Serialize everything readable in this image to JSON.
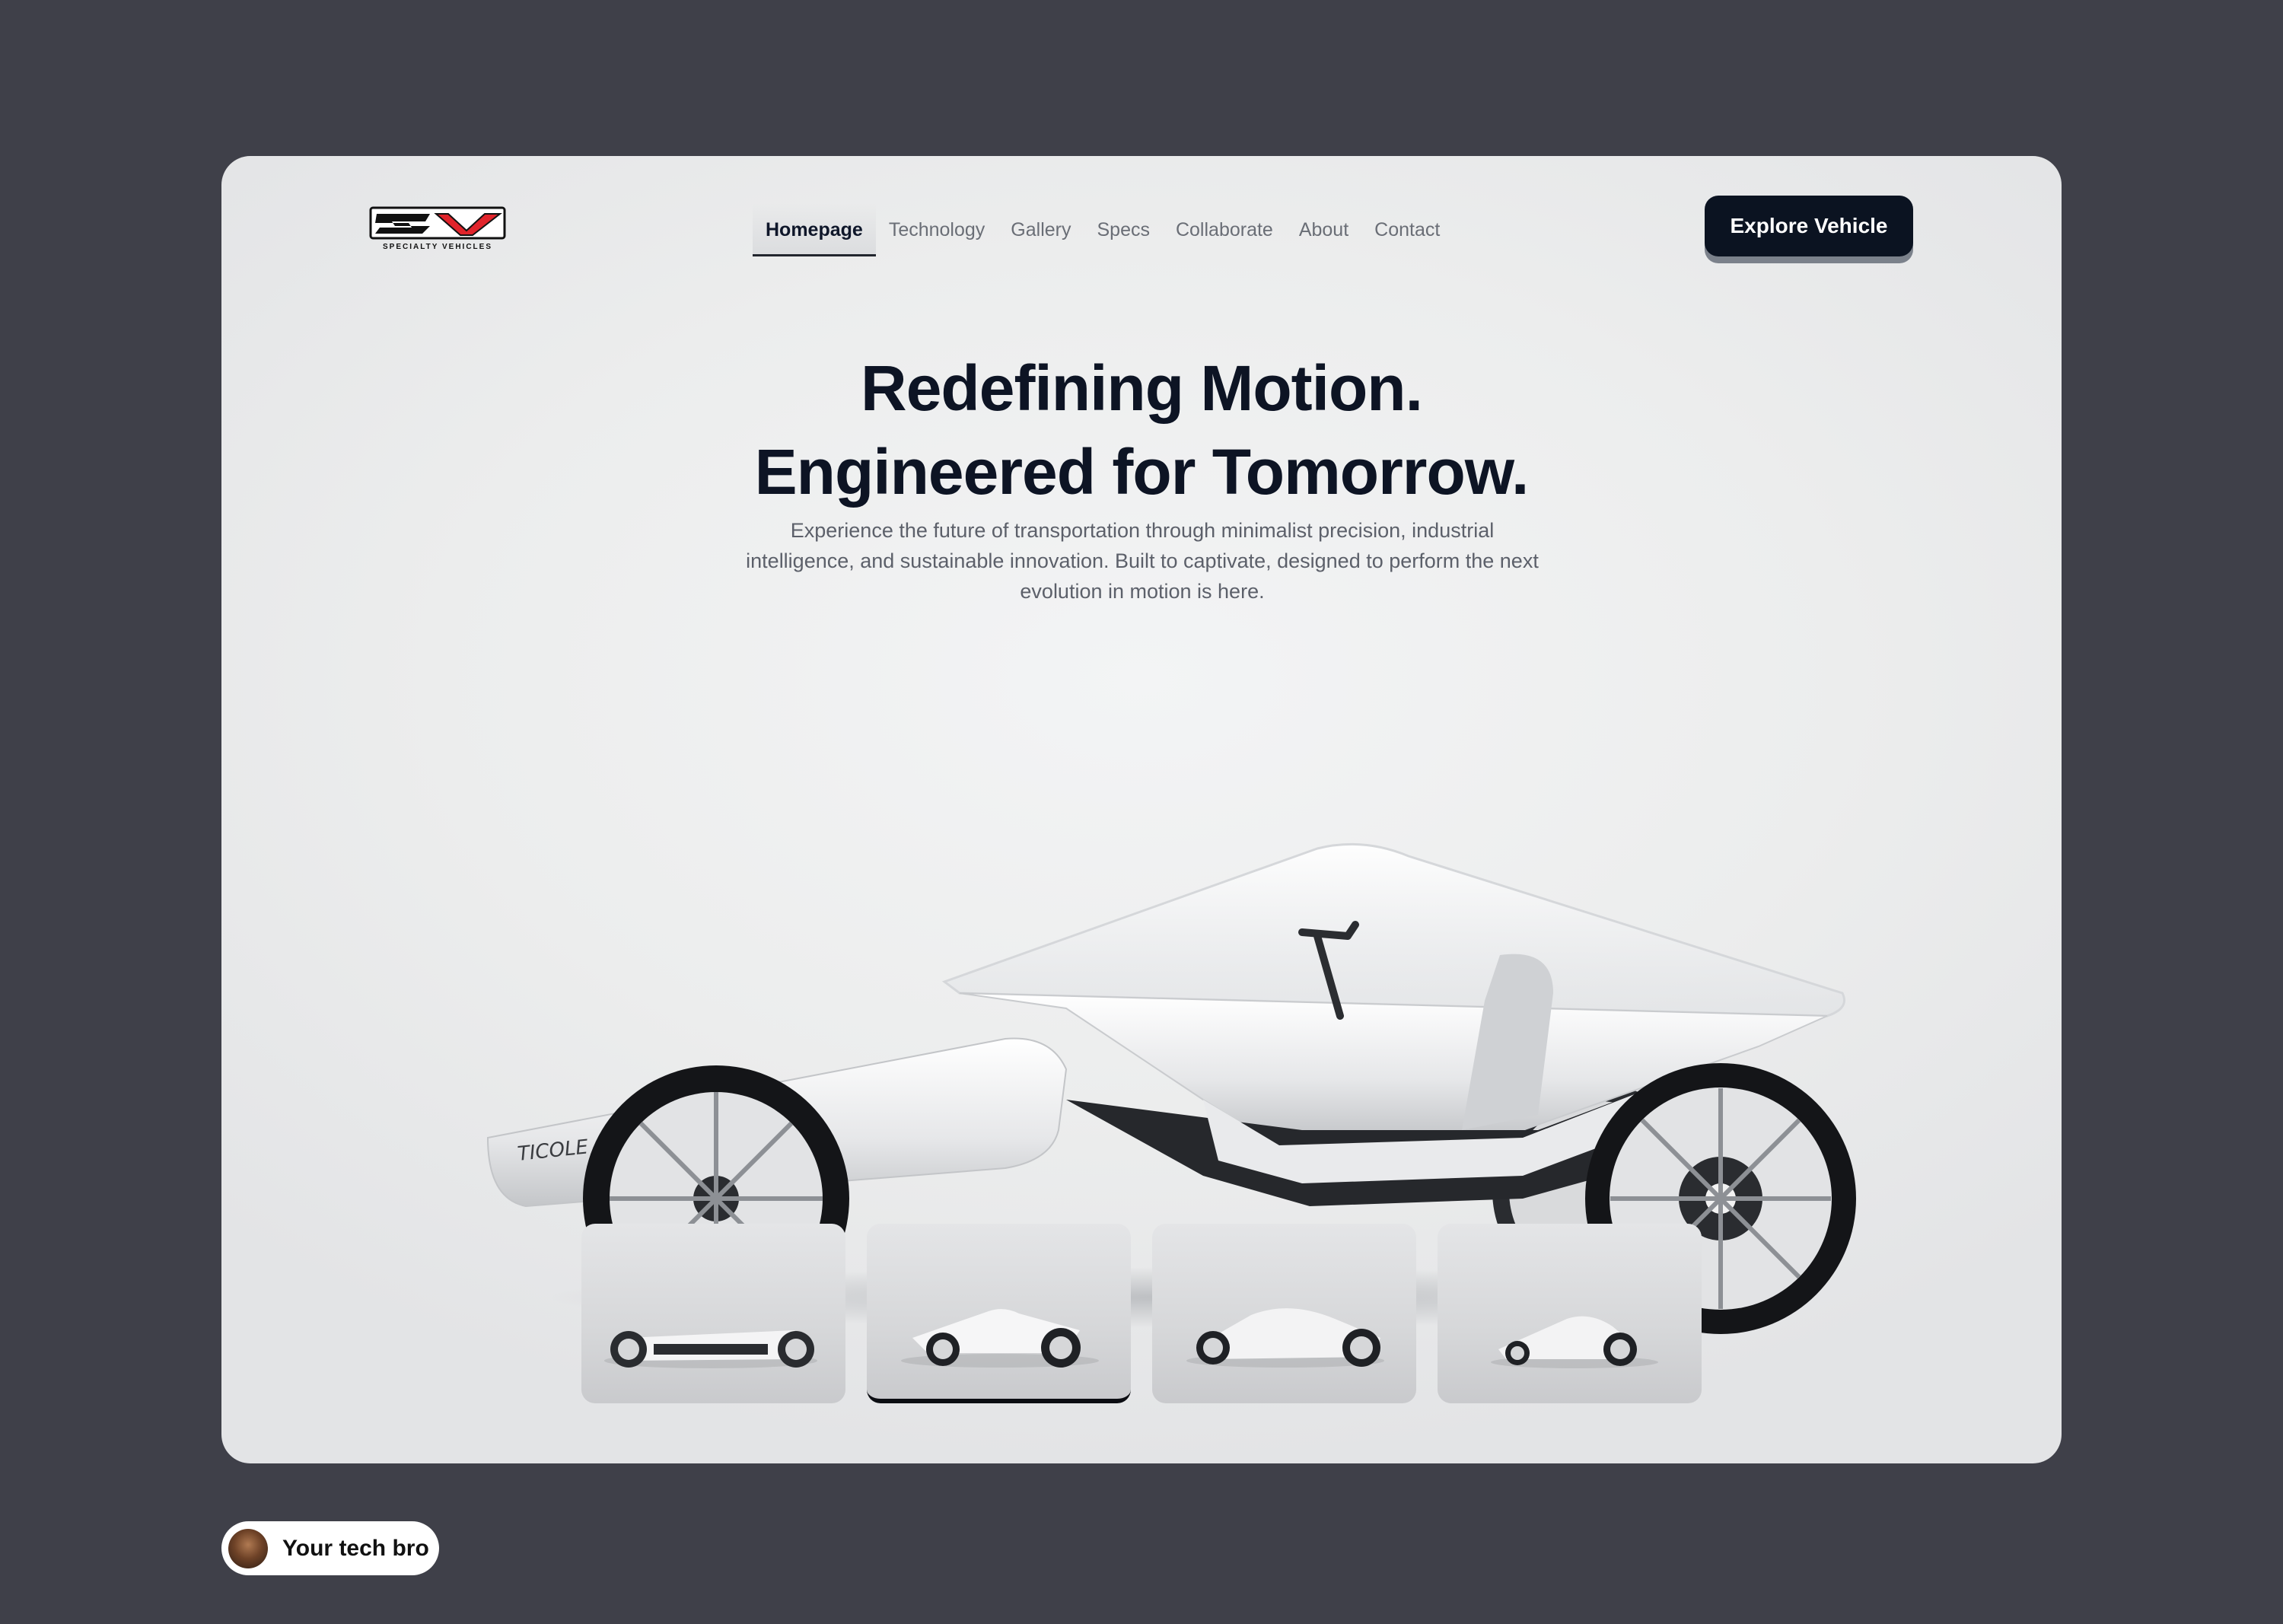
{
  "brand": {
    "logo_text": "SV",
    "logo_subtext": "SPECIALTY VEHICLES"
  },
  "nav": [
    {
      "label": "Homepage",
      "active": true
    },
    {
      "label": "Technology",
      "active": false
    },
    {
      "label": "Gallery",
      "active": false
    },
    {
      "label": "Specs",
      "active": false
    },
    {
      "label": "Collaborate",
      "active": false
    },
    {
      "label": "About",
      "active": false
    },
    {
      "label": "Contact",
      "active": false
    }
  ],
  "cta": {
    "label": "Explore Vehicle"
  },
  "hero": {
    "line1": "Redefining Motion.",
    "line2": "Engineered for Tomorrow.",
    "subtitle": "Experience the future of transportation through minimalist precision, industrial intelligence, and sustainable innovation. Built to captivate, designed to perform  the next evolution in motion is here.",
    "vehicle_badge": "TICOLE"
  },
  "thumbnails": {
    "count": 4,
    "selected_index": 1
  },
  "footer_badge": {
    "name": "Your tech bro"
  },
  "colors": {
    "page_bg": "#3f4049",
    "card_bg": "#eceded",
    "primary_dark": "#0b1321",
    "heading": "#0d1424",
    "body_text": "#5c606a",
    "logo_red": "#e0242b"
  }
}
